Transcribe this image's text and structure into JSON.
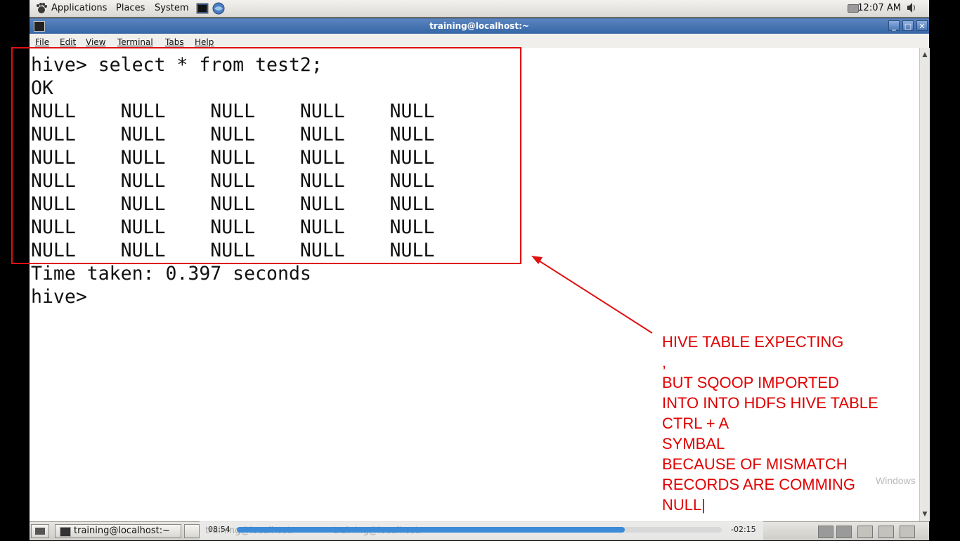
{
  "top_panel": {
    "menus": [
      "Applications",
      "Places",
      "System"
    ],
    "clock": "12:07 AM"
  },
  "window": {
    "title": "training@localhost:~",
    "controls": [
      "_",
      "□",
      "✕"
    ],
    "menu": [
      "File",
      "Edit",
      "View",
      "Terminal",
      "Tabs",
      "Help"
    ]
  },
  "terminal": {
    "lines": [
      "hive> select * from test2;",
      "OK",
      "NULL    NULL    NULL    NULL    NULL",
      "NULL    NULL    NULL    NULL    NULL",
      "NULL    NULL    NULL    NULL    NULL",
      "NULL    NULL    NULL    NULL    NULL",
      "NULL    NULL    NULL    NULL    NULL",
      "NULL    NULL    NULL    NULL    NULL",
      "NULL    NULL    NULL    NULL    NULL",
      "Time taken: 0.397 seconds",
      "hive>"
    ]
  },
  "annotation": {
    "lines": [
      "HIVE TABLE EXPECTING",
      ",",
      "BUT SQOOP IMPORTED",
      "INTO INTO HDFS HIVE TABLE",
      "CTRL + A",
      "SYMBAL",
      "BECAUSE OF MISMATCH",
      "RECORDS ARE COMMING",
      "NULL|"
    ],
    "color": "#e00000",
    "watermark": "Windows"
  },
  "bottom_panel": {
    "task": "training@localhost:~",
    "ghost_task_1": "training@localhost:~",
    "ghost_task_2": "training@localhost:~"
  },
  "player": {
    "elapsed": "08:54",
    "remaining": "-02:15",
    "progress_fraction": 0.8
  }
}
